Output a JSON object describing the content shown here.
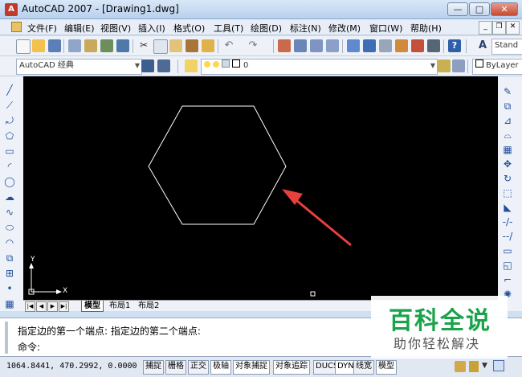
{
  "window": {
    "title": "AutoCAD 2007 - [Drawing1.dwg]"
  },
  "menubar": {
    "items": [
      "文件(F)",
      "编辑(E)",
      "视图(V)",
      "插入(I)",
      "格式(O)",
      "工具(T)",
      "绘图(D)",
      "标注(N)",
      "修改(M)",
      "窗口(W)",
      "帮助(H)"
    ]
  },
  "toolbar2": {
    "workspace": "AutoCAD 经典",
    "layer": "0",
    "color": "ByLayer",
    "text_style": "Stand"
  },
  "tabs": {
    "model": "模型",
    "layout1": "布局1",
    "layout2": "布局2"
  },
  "ucs": {
    "y": "Y",
    "x": "X"
  },
  "command": {
    "line1": "指定边的第一个端点: 指定边的第二个端点:",
    "line2": "命令:"
  },
  "status": {
    "coords": "1064.8441, 470.2992, 0.0000",
    "buttons": [
      "捕捉",
      "栅格",
      "正交",
      "极轴",
      "对象捕捉",
      "对象追踪",
      "DUCS",
      "DYN",
      "线宽",
      "模型"
    ]
  },
  "watermark": {
    "main": "百科全说",
    "sub": "助你轻松解决"
  },
  "colors": {
    "arrow": "#e8403c",
    "canvas": "#000000",
    "shape": "#ffffff",
    "watermark": "#1aa34a"
  }
}
